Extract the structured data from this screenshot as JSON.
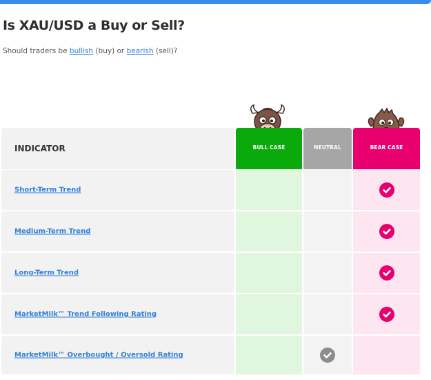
{
  "page": {
    "title": "Is XAU/USD a Buy or Sell?",
    "subtitle_prefix": "Should traders be ",
    "bullish_link": "bullish",
    "subtitle_mid1": " (buy) or ",
    "bearish_link": "bearish",
    "subtitle_suffix": " (sell)?"
  },
  "table": {
    "headers": {
      "indicator": "INDICATOR",
      "bull": "BULL CASE",
      "neutral": "NEUTRAL",
      "bear": "BEAR CASE"
    },
    "rows": [
      {
        "label": "Short-Term Trend",
        "verdict": "bear"
      },
      {
        "label": "Medium-Term Trend",
        "verdict": "bear"
      },
      {
        "label": "Long-Term Trend",
        "verdict": "bear"
      },
      {
        "label": "MarketMilk™ Trend Following Rating",
        "verdict": "bear"
      },
      {
        "label": "MarketMilk™ Overbought / Oversold Rating",
        "verdict": "neutral"
      }
    ]
  },
  "colors": {
    "accent": "#3b8ee8",
    "bull": "#0aaa0c",
    "neutral": "#a6a6a6",
    "bear": "#e8006e",
    "bull_light": "#e0f6de",
    "bear_light": "#fde6ef"
  },
  "icons": {
    "bull_mascot": "bull-mascot-icon",
    "bear_mascot": "bear-mascot-icon",
    "check": "checkmark-circle-icon"
  }
}
